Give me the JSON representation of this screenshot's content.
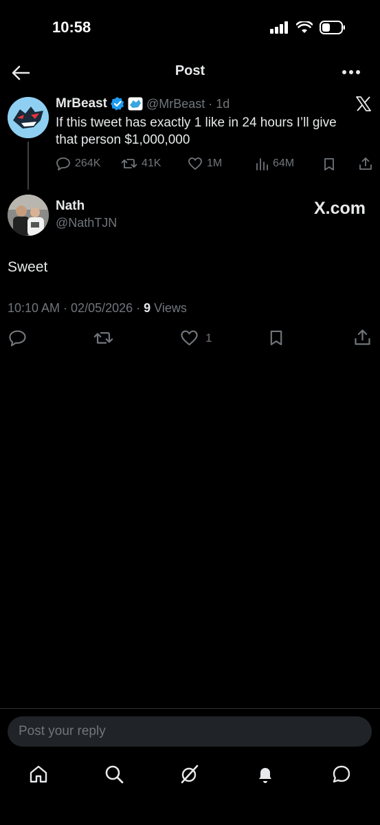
{
  "status": {
    "time": "10:58"
  },
  "topbar": {
    "title": "Post"
  },
  "quoted": {
    "name": "MrBeast",
    "handle": "@MrBeast",
    "age": "· 1d",
    "text_line1": "If this tweet has exactly 1 like in 24 hours I’ll give",
    "text_line2": "that person $1,000,000",
    "replies": "264K",
    "reposts": "41K",
    "likes": "1M",
    "views": "64M"
  },
  "reply": {
    "name": "Nath",
    "handle": "@NathTJN",
    "text": "Sweet",
    "timestamp": "10:10 AM · 02/05/2026 · ",
    "views_count": "9",
    "views_label": " Views",
    "likes": "1",
    "watermark": "X.com"
  },
  "composer": {
    "placeholder": "Post your reply"
  },
  "colors": {
    "accent": "#1d9bf0",
    "muted": "#71767b",
    "text": "#e7e9ea"
  }
}
